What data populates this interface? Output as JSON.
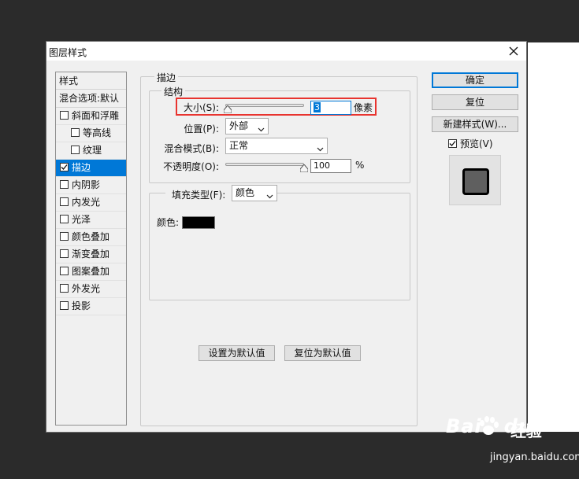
{
  "dialog": {
    "title": "图层样式"
  },
  "style_list": {
    "header": "样式",
    "blend_options": "混合选项:默认",
    "items": [
      {
        "label": "斜面和浮雕",
        "checked": false,
        "sub": false,
        "selected": false
      },
      {
        "label": "等高线",
        "checked": false,
        "sub": true,
        "selected": false
      },
      {
        "label": "纹理",
        "checked": false,
        "sub": true,
        "selected": false
      },
      {
        "label": "描边",
        "checked": true,
        "sub": false,
        "selected": true
      },
      {
        "label": "内阴影",
        "checked": false,
        "sub": false,
        "selected": false
      },
      {
        "label": "内发光",
        "checked": false,
        "sub": false,
        "selected": false
      },
      {
        "label": "光泽",
        "checked": false,
        "sub": false,
        "selected": false
      },
      {
        "label": "颜色叠加",
        "checked": false,
        "sub": false,
        "selected": false
      },
      {
        "label": "渐变叠加",
        "checked": false,
        "sub": false,
        "selected": false
      },
      {
        "label": "图案叠加",
        "checked": false,
        "sub": false,
        "selected": false
      },
      {
        "label": "外发光",
        "checked": false,
        "sub": false,
        "selected": false
      },
      {
        "label": "投影",
        "checked": false,
        "sub": false,
        "selected": false
      }
    ]
  },
  "stroke": {
    "title": "描边",
    "structure_title": "结构",
    "size_label": "大小(S):",
    "size_value": "3",
    "size_unit": "像素",
    "size_fraction": 0.03,
    "position_label": "位置(P):",
    "position_value": "外部",
    "blend_label": "混合模式(B):",
    "blend_value": "正常",
    "opacity_label": "不透明度(O):",
    "opacity_value": "100",
    "opacity_unit": "%",
    "opacity_fraction": 1.0,
    "fill_type_label": "填充类型(F):",
    "fill_type_value": "颜色",
    "color_label": "颜色:",
    "color_value": "#000000"
  },
  "buttons": {
    "ok": "确定",
    "reset": "复位",
    "new_style": "新建样式(W)...",
    "preview_label": "预览(V)",
    "preview_checked": true,
    "set_default": "设置为默认值",
    "reset_default": "复位为默认值"
  },
  "watermark": {
    "brand": "Bai",
    "brand_suffix": "du",
    "cn": "经验",
    "url": "jingyan.baidu.com"
  },
  "colors": {
    "accent": "#0078d7",
    "highlight": "#e8342f"
  }
}
